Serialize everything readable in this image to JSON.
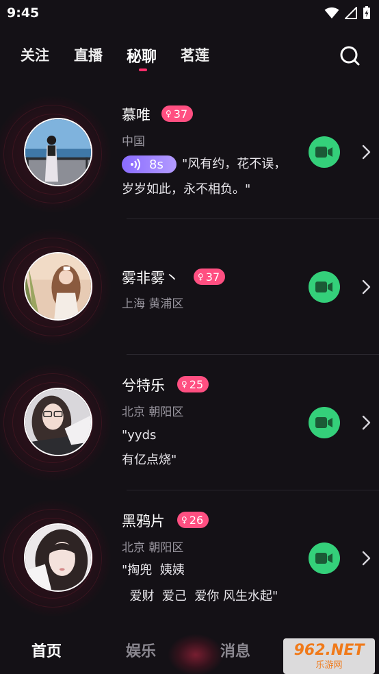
{
  "status_bar": {
    "time": "9:45"
  },
  "top_tabs": [
    {
      "label": "关注"
    },
    {
      "label": "直播"
    },
    {
      "label": "秘聊",
      "active": true
    },
    {
      "label": "茗莲"
    }
  ],
  "cards": [
    {
      "name": "慕唯",
      "age": "37",
      "location": "中国",
      "voice": "8s",
      "quote_line1": "\"风有约，花不误，",
      "quote_line2": "岁岁如此，永不相负。\""
    },
    {
      "name": "雾非雾丶",
      "age": "37",
      "location": "上海 黄浦区"
    },
    {
      "name": "兮特乐",
      "age": "25",
      "location": "北京 朝阳区",
      "quote_line1": "\"yyds",
      "quote_line2": "有亿点烧\""
    },
    {
      "name": "黑鸦片",
      "age": "26",
      "location": "北京 朝阳区",
      "quote_line1": "\"掏兜  姨姨",
      "quote_line2": "  爱财  爱己  爱你 风生水起\""
    }
  ],
  "bottom_nav": [
    {
      "label": "首页",
      "active": true
    },
    {
      "label": "娱乐"
    },
    {
      "label": "消息"
    }
  ],
  "watermark": {
    "top": "962.NET",
    "bottom": "乐游网"
  },
  "colors": {
    "accent": "#ff2d6a",
    "badge": "#ff4f81",
    "video_button": "#34d07a",
    "voice_pill": "#9b82ff",
    "background": "#141116"
  }
}
